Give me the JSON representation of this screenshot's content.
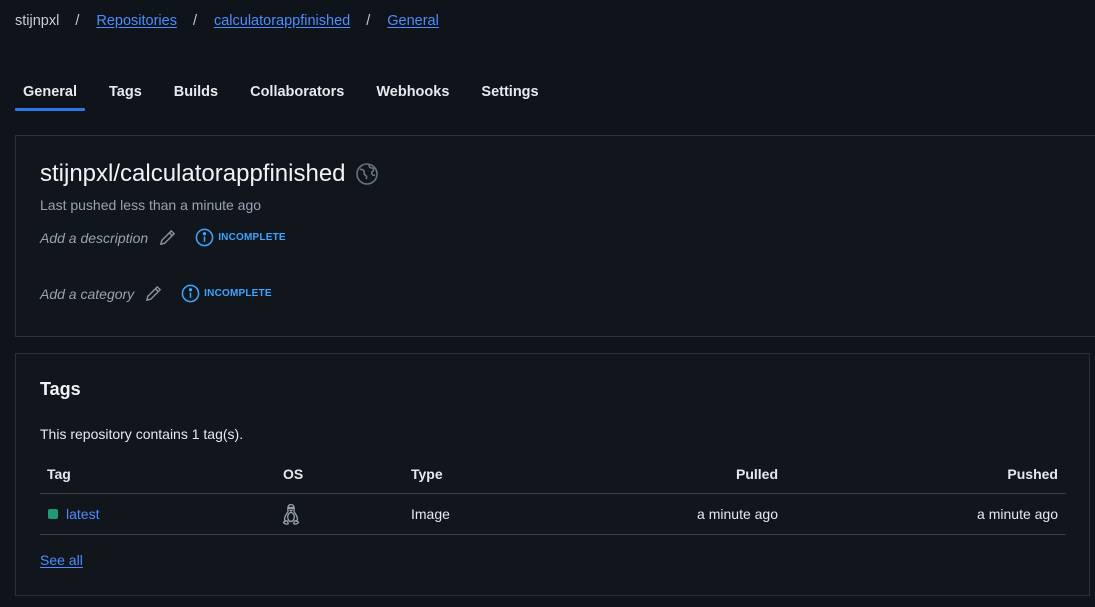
{
  "breadcrumb": {
    "user": "stijnpxl",
    "separator": "/",
    "repositories": "Repositories",
    "repo": "calculatorappfinished",
    "current": "General"
  },
  "tabs": [
    {
      "label": "General",
      "active": true
    },
    {
      "label": "Tags",
      "active": false
    },
    {
      "label": "Builds",
      "active": false
    },
    {
      "label": "Collaborators",
      "active": false
    },
    {
      "label": "Webhooks",
      "active": false
    },
    {
      "label": "Settings",
      "active": false
    }
  ],
  "repo": {
    "full_name": "stijnpxl/calculatorappfinished",
    "visibility_icon": "globe-icon",
    "last_pushed": "Last pushed less than a minute ago",
    "description_placeholder": "Add a description",
    "category_placeholder": "Add a category",
    "incomplete_label": "INCOMPLETE"
  },
  "tags_section": {
    "title": "Tags",
    "count_text": "This repository contains 1 tag(s).",
    "columns": {
      "tag": "Tag",
      "os": "OS",
      "type": "Type",
      "pulled": "Pulled",
      "pushed": "Pushed"
    },
    "rows": [
      {
        "tag": "latest",
        "os_icon": "linux-icon",
        "type": "Image",
        "pulled": "a minute ago",
        "pushed": "a minute ago"
      }
    ],
    "see_all": "See all"
  },
  "colors": {
    "background": "#0f131a",
    "accent": "#2c7be5",
    "link": "#4c8dff",
    "incomplete": "#3ea6ff",
    "tag_status": "#1e9a7a"
  }
}
